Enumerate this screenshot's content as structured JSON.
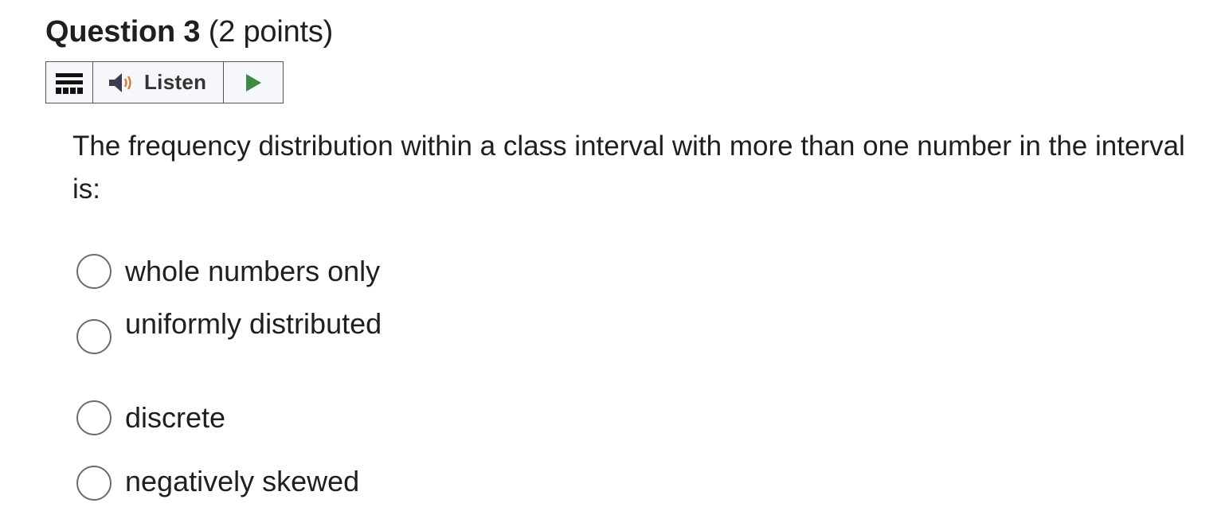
{
  "question": {
    "title": "Question 3",
    "points": "(2 points)",
    "text": "The frequency distribution within a class interval with more than one number in the interval is:"
  },
  "toolbar": {
    "menu_icon": "hamburger-menu-icon",
    "listen_icon": "speaker-icon",
    "listen_label": "Listen",
    "play_icon": "play-icon",
    "play_color": "#3d8a47",
    "speaker_wave_color": "#e07a3a"
  },
  "options": [
    {
      "label": "whole numbers only",
      "selected": false
    },
    {
      "label": "uniformly distributed",
      "selected": false
    },
    {
      "label": "discrete",
      "selected": false
    },
    {
      "label": "negatively skewed",
      "selected": false
    }
  ]
}
